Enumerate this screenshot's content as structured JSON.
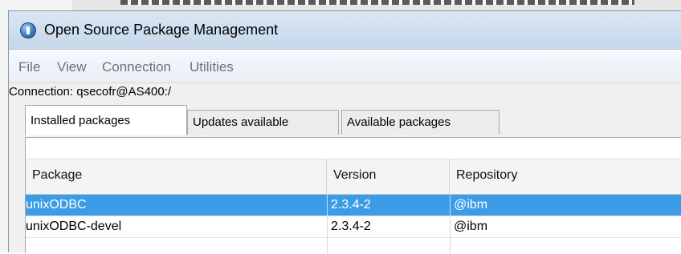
{
  "window": {
    "title": "Open Source Package Management"
  },
  "menu": [
    {
      "label": "File"
    },
    {
      "label": "View"
    },
    {
      "label": "Connection"
    },
    {
      "label": "Utilities"
    }
  ],
  "connection": {
    "label": "Connection: qsecofr@AS400:/"
  },
  "tabs": [
    {
      "label": "Installed packages",
      "active": true
    },
    {
      "label": "Updates available",
      "active": false
    },
    {
      "label": "Available packages",
      "active": false
    }
  ],
  "table": {
    "columns": [
      "Package",
      "Version",
      "Repository"
    ],
    "rows": [
      {
        "package": "unixODBC",
        "version": "2.3.4-2",
        "repository": "@ibm",
        "selected": true
      },
      {
        "package": "unixODBC-devel",
        "version": "2.3.4-2",
        "repository": "@ibm",
        "selected": false
      }
    ]
  },
  "colors": {
    "selection": "#3d9ce6",
    "titlebar": "#d9e6f4"
  }
}
